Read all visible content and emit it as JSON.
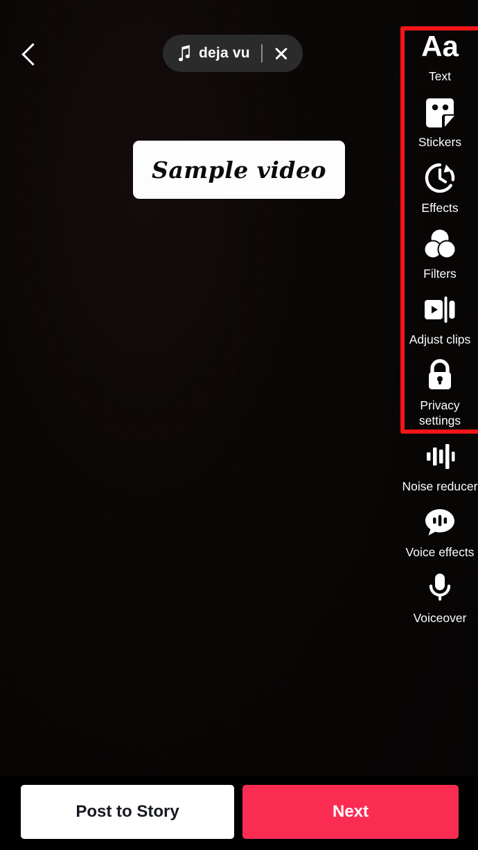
{
  "app": "TikTok video editor",
  "header": {
    "back_icon": "chevron-left-icon",
    "music": {
      "icon": "music-note-icon",
      "title": "deja vu",
      "close_icon": "close-icon"
    }
  },
  "canvas": {
    "overlay_text": "Sample video"
  },
  "tools": [
    {
      "icon": "text-aa-icon",
      "label": "Text",
      "in_highlight": true
    },
    {
      "icon": "sticker-icon",
      "label": "Stickers",
      "in_highlight": true
    },
    {
      "icon": "effects-clock-icon",
      "label": "Effects",
      "in_highlight": true
    },
    {
      "icon": "filters-circles-icon",
      "label": "Filters",
      "in_highlight": true
    },
    {
      "icon": "adjust-clips-icon",
      "label": "Adjust clips",
      "in_highlight": true
    },
    {
      "icon": "lock-icon",
      "label": "Privacy settings",
      "in_highlight": false
    },
    {
      "icon": "waveform-icon",
      "label": "Noise reducer",
      "in_highlight": false
    },
    {
      "icon": "voice-bubble-icon",
      "label": "Voice effects",
      "in_highlight": false
    },
    {
      "icon": "microphone-icon",
      "label": "Voiceover",
      "in_highlight": false
    }
  ],
  "annotation": {
    "shape": "rectangle",
    "color": "#f41518"
  },
  "bottom": {
    "post_to_story": "Post to Story",
    "next": "Next"
  },
  "colors": {
    "accent_red": "#fb2c52",
    "annotation_red": "#f41518",
    "pill_bg": "#2b2b2b",
    "canvas_bg": "#0a0606"
  }
}
